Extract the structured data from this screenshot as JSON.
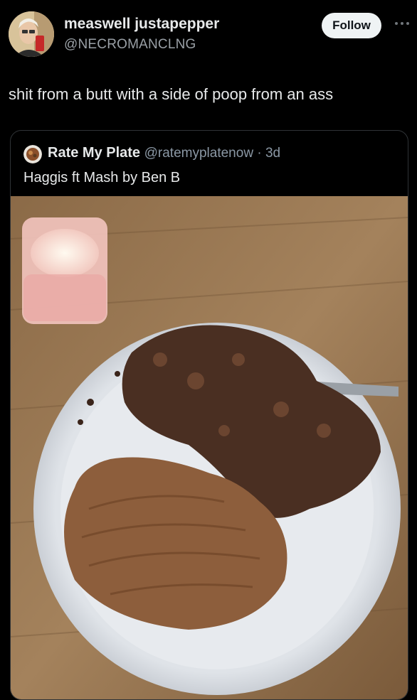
{
  "author": {
    "display_name": "measwell justapepper",
    "handle": "@NECROMANCLNG"
  },
  "follow_label": "Follow",
  "tweet_text": "shit from a butt with a side of poop from an ass",
  "quoted": {
    "display_name": "Rate My Plate",
    "handle": "@ratemyplatenow",
    "age": "3d",
    "text": "Haggis ft Mash by Ben B"
  },
  "colors": {
    "background": "#000000",
    "follow_button": "#eff3f4",
    "secondary_text": "#8b98a5"
  },
  "icons": [
    "more-options-icon"
  ]
}
